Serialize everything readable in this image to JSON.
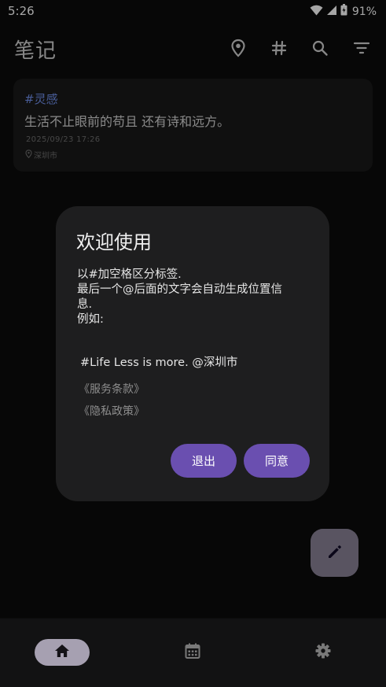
{
  "status_bar": {
    "time": "5:26",
    "battery_percent": "91%",
    "icons": [
      "wifi-icon",
      "cellular-icon",
      "battery-icon"
    ]
  },
  "app_bar": {
    "title": "笔记",
    "actions": [
      "location-icon",
      "hashtag-icon",
      "search-icon",
      "filter-icon"
    ]
  },
  "notes": [
    {
      "tag": "#灵感",
      "text": "生活不止眼前的苟且 还有诗和远方。",
      "date": "2025/09/23 17:26",
      "location": "深圳市"
    }
  ],
  "dialog": {
    "title": "欢迎使用",
    "body_lines": [
      "以#加空格区分标签.",
      "最后一个@后面的文字会自动生成位置信",
      "息.",
      "例如:"
    ],
    "example": "#Life Less is more. @深圳市",
    "terms_link": "《服务条款》",
    "privacy_link": "《隐私政策》",
    "exit_button": "退出",
    "agree_button": "同意"
  },
  "fab": {
    "icon": "edit-icon"
  },
  "bottom_nav": {
    "items": [
      {
        "icon": "home-icon",
        "active": true
      },
      {
        "icon": "calendar-icon",
        "active": false
      },
      {
        "icon": "settings-icon",
        "active": false
      }
    ]
  },
  "colors": {
    "background": "#0b0b0b",
    "card": "#1a1a1a",
    "dialog": "#1e1e1f",
    "tag": "#6f8ee8",
    "button": "#6a4fb0",
    "fab": "#ded2f3",
    "nav_active": "#e6def5"
  }
}
